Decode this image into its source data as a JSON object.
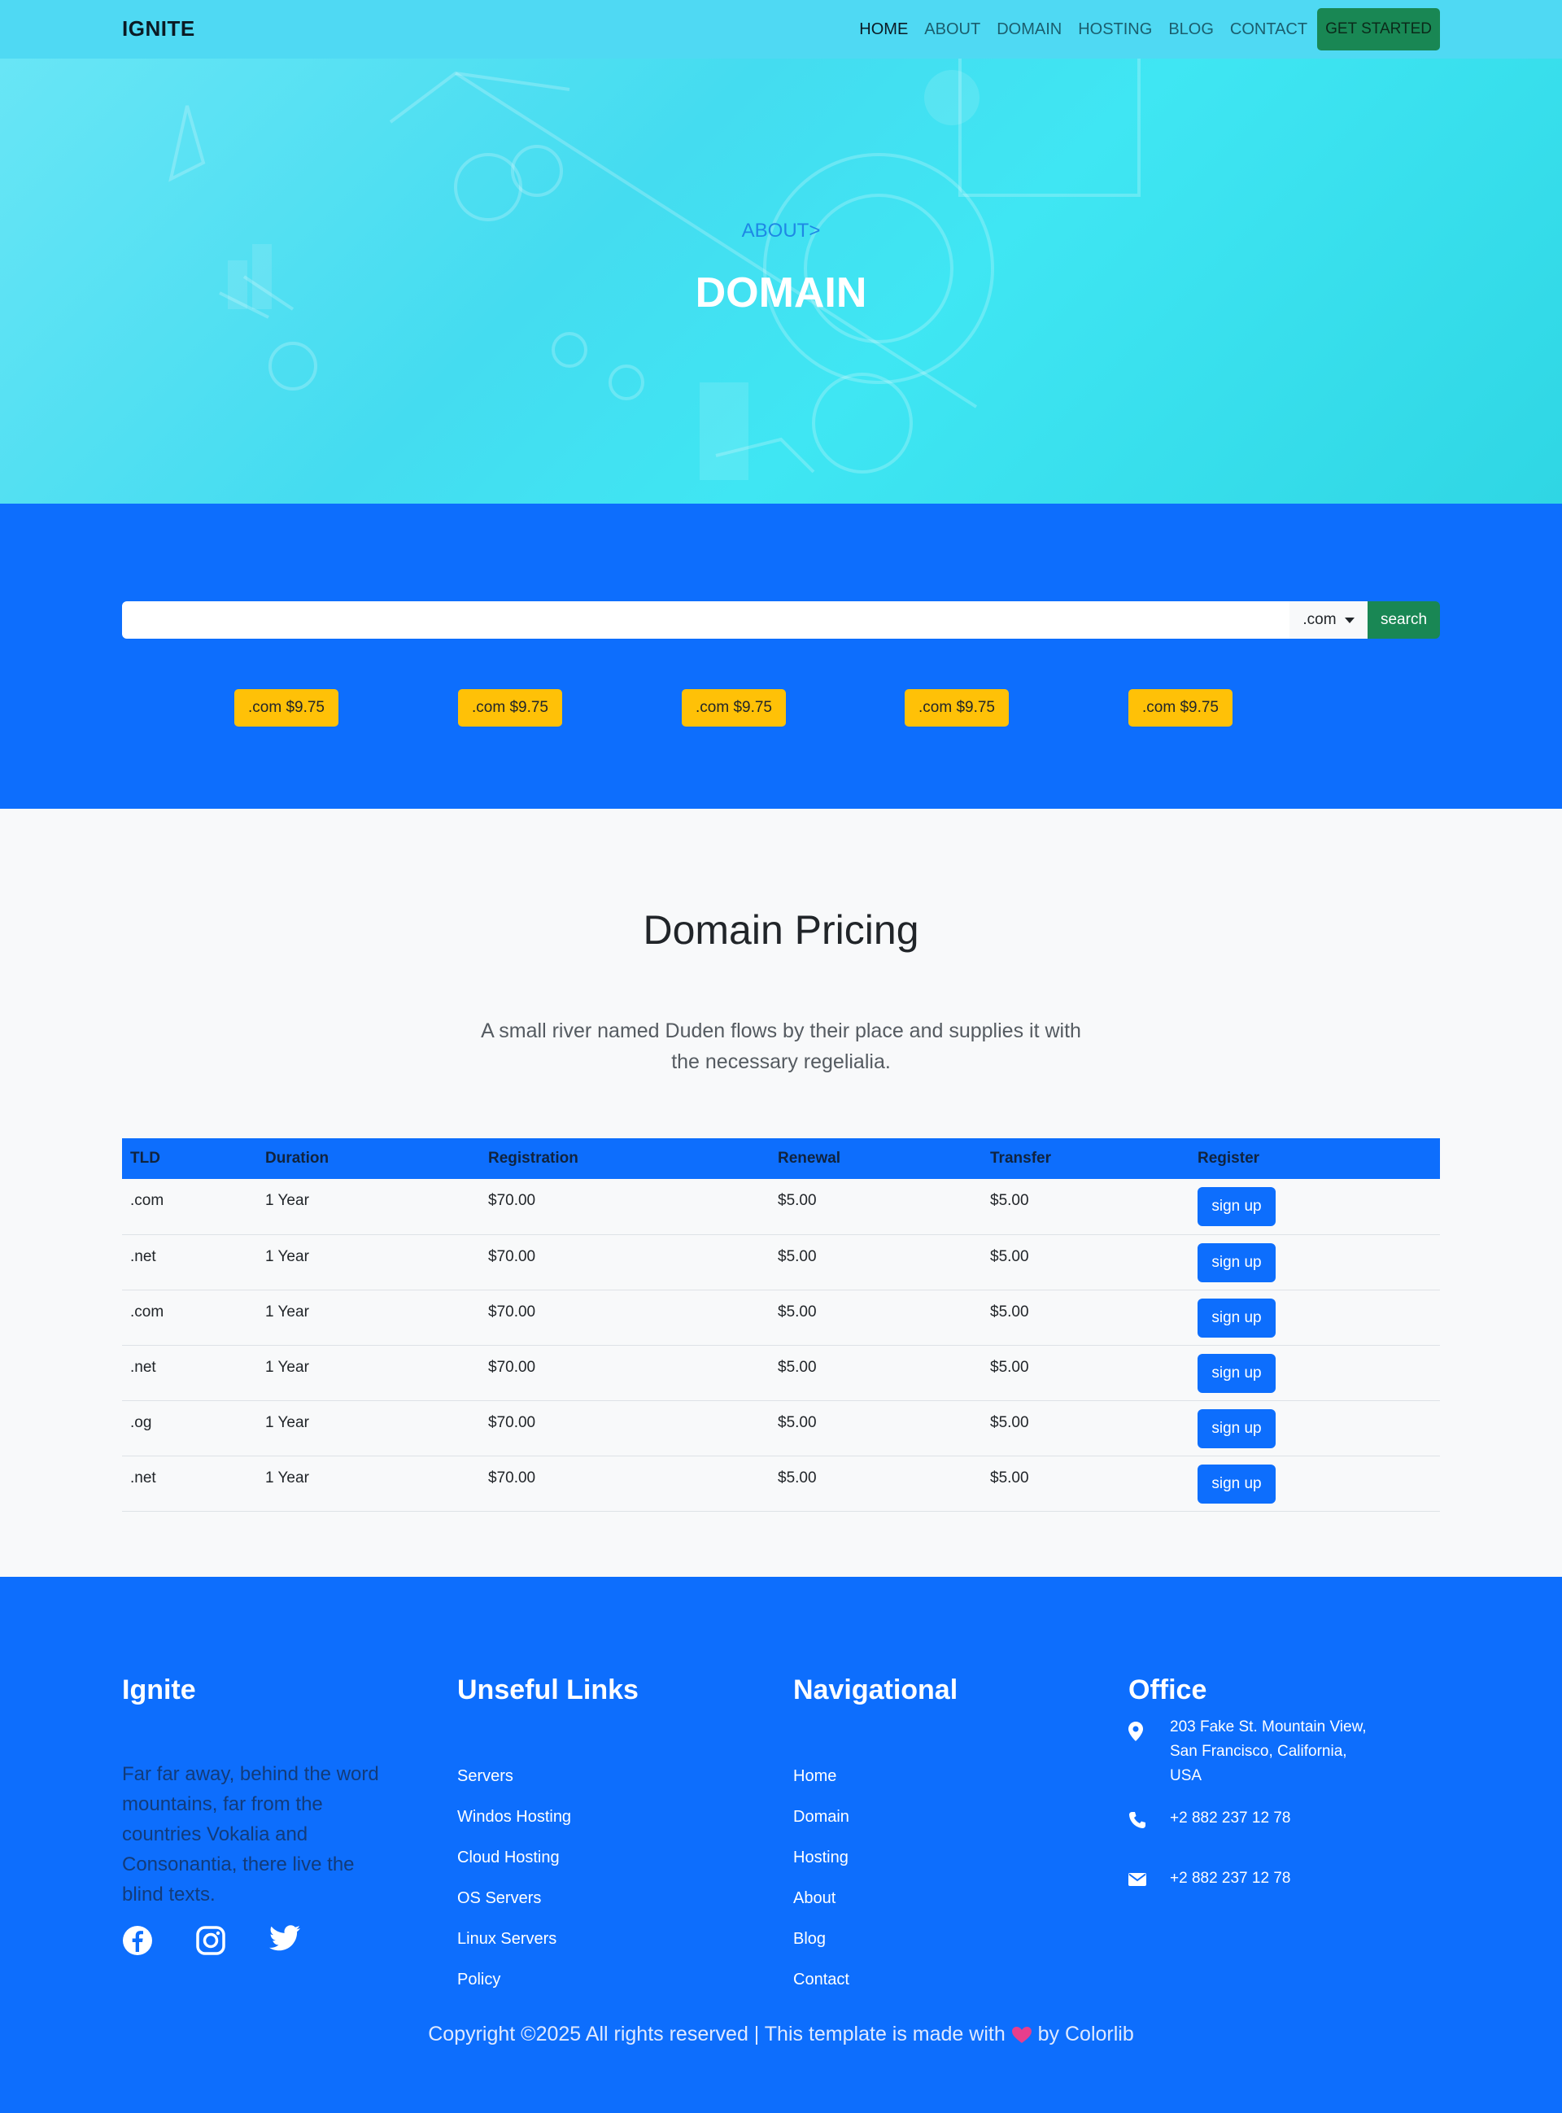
{
  "navbar": {
    "brand": "IGNITE",
    "links": [
      "HOME",
      "ABOUT",
      "DOMAIN",
      "HOSTING",
      "BLOG",
      "CONTACT"
    ],
    "cta": "GET STARTED"
  },
  "hero": {
    "breadcrumb": "ABOUT>",
    "title": "DOMAIN"
  },
  "search": {
    "placeholder": "",
    "tld": ".com",
    "button": "search",
    "price_tags": [
      ".com $9.75",
      ".com $9.75",
      ".com $9.75",
      ".com $9.75",
      ".com $9.75"
    ]
  },
  "pricing": {
    "title": "Domain Pricing",
    "description": "A small river named Duden flows by their place and supplies it with the necessary regelialia.",
    "headers": [
      "TLD",
      "Duration",
      "Registration",
      "Renewal",
      "Transfer",
      "Register"
    ],
    "rows": [
      {
        "tld": ".com",
        "duration": "1 Year",
        "registration": "$70.00",
        "renewal": "$5.00",
        "transfer": "$5.00",
        "action": "sign up"
      },
      {
        "tld": ".net",
        "duration": "1 Year",
        "registration": "$70.00",
        "renewal": "$5.00",
        "transfer": "$5.00",
        "action": "sign up"
      },
      {
        "tld": ".com",
        "duration": "1 Year",
        "registration": "$70.00",
        "renewal": "$5.00",
        "transfer": "$5.00",
        "action": "sign up"
      },
      {
        "tld": ".net",
        "duration": "1 Year",
        "registration": "$70.00",
        "renewal": "$5.00",
        "transfer": "$5.00",
        "action": "sign up"
      },
      {
        "tld": ".og",
        "duration": "1 Year",
        "registration": "$70.00",
        "renewal": "$5.00",
        "transfer": "$5.00",
        "action": "sign up"
      },
      {
        "tld": ".net",
        "duration": "1 Year",
        "registration": "$70.00",
        "renewal": "$5.00",
        "transfer": "$5.00",
        "action": "sign up"
      }
    ]
  },
  "footer": {
    "about_title": "Ignite",
    "about_text": "Far far away, behind the word mountains, far from the countries Vokalia and Consonantia, there live the blind texts.",
    "social_icons": [
      "facebook-icon",
      "instagram-icon",
      "twitter-icon"
    ],
    "useful_title": "Unseful Links",
    "useful_links": [
      "Servers",
      "Windos Hosting",
      "Cloud Hosting",
      "OS Servers",
      "Linux Servers",
      "Policy"
    ],
    "nav_title": "Navigational",
    "nav_links": [
      "Home",
      "Domain",
      "Hosting",
      "About",
      "Blog",
      "Contact"
    ],
    "office_title": "Office",
    "address": "203 Fake St. Mountain View, San Francisco, California, USA",
    "phone": "+2 882 237 12 78",
    "email": "+2 882 237 12 78",
    "copyright_before": "Copyright ©2025 All rights reserved | This template is made with",
    "copyright_after": "by Colorlib"
  },
  "colors": {
    "primary": "#0d6efd",
    "success": "#198754",
    "warning": "#ffc107",
    "hero": "#44dcf0"
  }
}
